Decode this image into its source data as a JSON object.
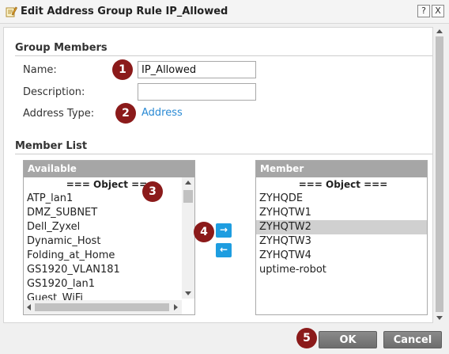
{
  "window": {
    "title": "Edit Address Group Rule IP_Allowed",
    "help_label": "?",
    "close_label": "X"
  },
  "group_members": {
    "section_title": "Group Members",
    "name_label": "Name:",
    "name_value": "IP_Allowed",
    "description_label": "Description:",
    "description_value": "",
    "address_type_label": "Address Type:",
    "address_type_value": "Address"
  },
  "member_list": {
    "section_title": "Member List",
    "available": {
      "header": "Available",
      "group_label": "=== Object ===",
      "items": [
        "ATP_lan1",
        "DMZ_SUBNET",
        "Dell_Zyxel",
        "Dynamic_Host",
        "Folding_at_Home",
        "GS1920_VLAN181",
        "GS1920_lan1",
        "Guest_WiFi"
      ]
    },
    "member": {
      "header": "Member",
      "group_label": "=== Object ===",
      "items": [
        "ZYHQDE",
        "ZYHQTW1",
        "ZYHQTW2",
        "ZYHQTW3",
        "ZYHQTW4",
        "uptime-robot"
      ],
      "selected": "ZYHQTW2"
    },
    "move_right_label": "→",
    "move_left_label": "←"
  },
  "badges": [
    "1",
    "2",
    "3",
    "4",
    "5"
  ],
  "footer": {
    "ok_label": "OK",
    "cancel_label": "Cancel"
  },
  "colors": {
    "badge": "#8b1a1a",
    "link": "#2a8ad4",
    "move_button": "#1e9de0",
    "list_header": "#a6a6a6",
    "footer_button": "#7a7a7a"
  }
}
